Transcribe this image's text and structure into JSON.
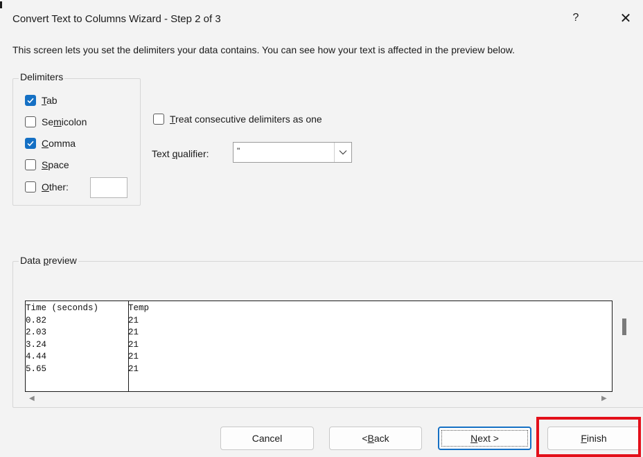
{
  "window": {
    "title": "Convert Text to Columns Wizard - Step 2 of 3",
    "help_glyph": "?",
    "close_glyph": "✕"
  },
  "intro_text": "This screen lets you set the delimiters your data contains.  You can see how your text is affected in the preview below.",
  "delimiters": {
    "legend": "Delimiters",
    "items": [
      {
        "pre": "",
        "key": "T",
        "post": "ab",
        "checked": true
      },
      {
        "pre": "Se",
        "key": "m",
        "post": "icolon",
        "checked": false
      },
      {
        "pre": "",
        "key": "C",
        "post": "omma",
        "checked": true
      },
      {
        "pre": "",
        "key": "S",
        "post": "pace",
        "checked": false
      },
      {
        "pre": "",
        "key": "O",
        "post": "ther:",
        "checked": false
      }
    ],
    "other_value": ""
  },
  "consecutive": {
    "pre": "",
    "key": "T",
    "post": "reat consecutive delimiters as one",
    "checked": false
  },
  "qualifier": {
    "pre": "Text ",
    "key": "q",
    "post": "ualifier:",
    "value": "\""
  },
  "preview": {
    "legend_pre": "Data ",
    "legend_key": "p",
    "legend_post": "review",
    "rows": [
      [
        "Time (seconds)",
        "Temp"
      ],
      [
        "0.82",
        "21"
      ],
      [
        "2.03",
        "21"
      ],
      [
        "3.24",
        "21"
      ],
      [
        "4.44",
        "21"
      ],
      [
        "5.65",
        "21"
      ]
    ]
  },
  "buttons": {
    "cancel": "Cancel",
    "back_pre": "< ",
    "back_key": "B",
    "back_post": "ack",
    "next_key": "N",
    "next_post": "ext >",
    "finish_key": "F",
    "finish_post": "inish"
  },
  "colors": {
    "accent": "#1570c4",
    "highlight": "#e3101a",
    "dialog_bg": "#f3f3f3"
  }
}
